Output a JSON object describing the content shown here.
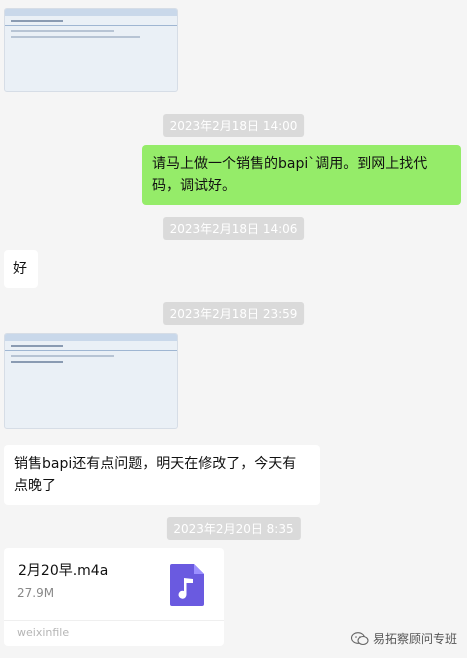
{
  "messages": {
    "time1": "2023年2月18日 14:00",
    "msg1": "请马上做一个销售的bapi`调用。到网上找代码，调试好。",
    "time2": "2023年2月18日 14:06",
    "msg2": "好",
    "time3": "2023年2月18日 23:59",
    "msg3": "销售bapi还有点问题，明天在修改了，今天有点晚了",
    "time4": "2023年2月20日 8:35"
  },
  "file": {
    "name": "2月20早.m4a",
    "size": "27.9M",
    "source": "weixinfile",
    "icon": "music-note-icon"
  },
  "watermark": {
    "label": "易拓察顾问专班",
    "icon": "wechat-logo"
  },
  "colors": {
    "bubble_right": "#95ec69",
    "bubble_left": "#ffffff",
    "file_icon": "#6a5ae0"
  }
}
